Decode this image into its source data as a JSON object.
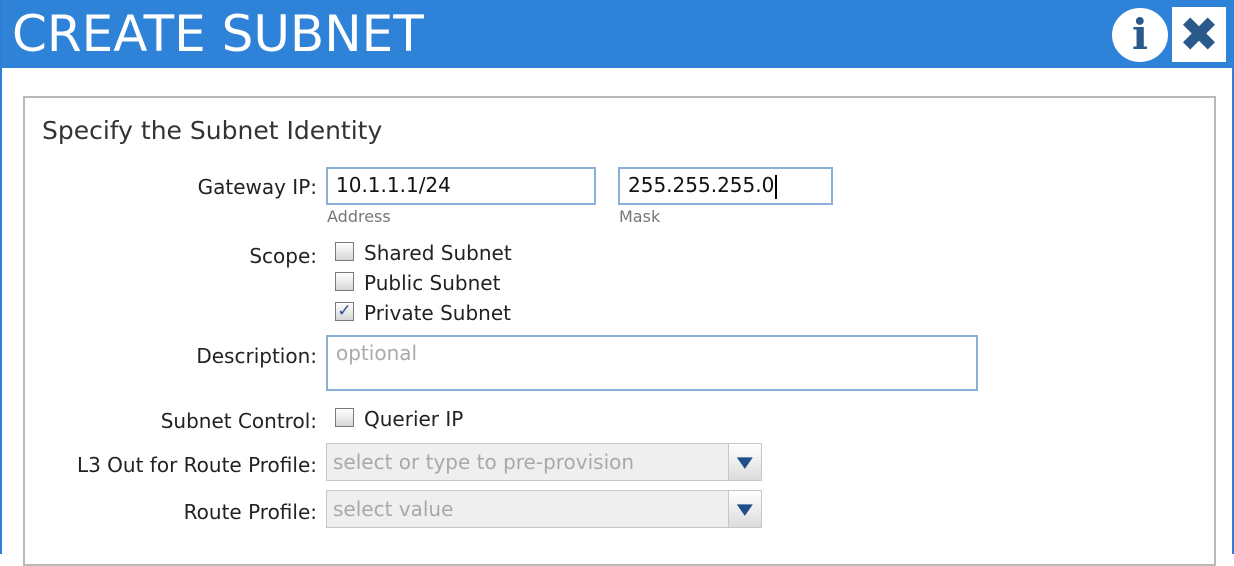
{
  "dialog": {
    "title": "CREATE SUBNET",
    "info_icon": "info-icon",
    "close_icon": "close-icon",
    "info_glyph": "i",
    "close_glyph": "✖"
  },
  "section": {
    "title": "Specify the Subnet Identity"
  },
  "gateway": {
    "label": "Gateway IP:",
    "address_value": "10.1.1.1/24",
    "address_sublabel": "Address",
    "mask_value": "255.255.255.0",
    "mask_sublabel": "Mask"
  },
  "scope": {
    "label": "Scope:",
    "options": [
      {
        "label": "Shared Subnet",
        "checked": false
      },
      {
        "label": "Public Subnet",
        "checked": false
      },
      {
        "label": "Private Subnet",
        "checked": true
      }
    ]
  },
  "description": {
    "label": "Description:",
    "placeholder": "optional"
  },
  "subnet_control": {
    "label": "Subnet Control:",
    "option_label": "Querier IP",
    "checked": false
  },
  "l3out": {
    "label": "L3 Out for Route Profile:",
    "placeholder": "select or type to pre-provision"
  },
  "route_profile": {
    "label": "Route Profile:",
    "placeholder": "select value"
  },
  "colors": {
    "titlebar": "#2e82d7",
    "field_border": "#8ab0d8",
    "icon": "#2a5a8c"
  }
}
